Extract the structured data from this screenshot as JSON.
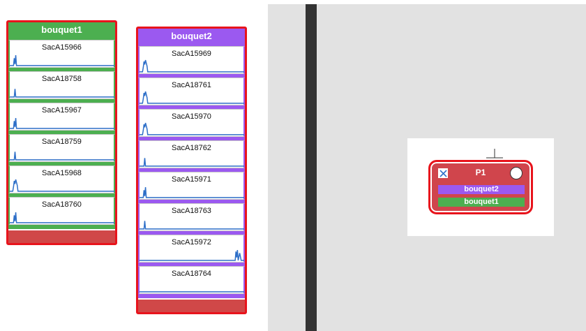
{
  "colors": {
    "selection_border": "#e8141c",
    "bouquet1": "#4caf50",
    "bouquet2": "#9b59f0",
    "node_fill": "#d0454c",
    "trace": "#2e6fc8",
    "footer": "#d04848"
  },
  "bouquets": [
    {
      "title": "bouquet1",
      "color_key": "bouquet1",
      "samples": [
        {
          "label": "SacA15966",
          "trace_shape": "spike-early"
        },
        {
          "label": "SacA18758",
          "trace_shape": "spike-thin"
        },
        {
          "label": "SacA15967",
          "trace_shape": "spike-early"
        },
        {
          "label": "SacA18759",
          "trace_shape": "spike-thin"
        },
        {
          "label": "SacA15968",
          "trace_shape": "spike-wide"
        },
        {
          "label": "SacA18760",
          "trace_shape": "spike-early"
        }
      ]
    },
    {
      "title": "bouquet2",
      "color_key": "bouquet2",
      "samples": [
        {
          "label": "SacA15969",
          "trace_shape": "spike-wide"
        },
        {
          "label": "SacA18761",
          "trace_shape": "spike-wide"
        },
        {
          "label": "SacA15970",
          "trace_shape": "spike-wide"
        },
        {
          "label": "SacA18762",
          "trace_shape": "spike-thin"
        },
        {
          "label": "SacA15971",
          "trace_shape": "spike-early"
        },
        {
          "label": "SacA18763",
          "trace_shape": "spike-thin"
        },
        {
          "label": "SacA15972",
          "trace_shape": "spike-late"
        },
        {
          "label": "SacA18764",
          "trace_shape": "flat"
        }
      ]
    }
  ],
  "node": {
    "title": "P1",
    "checkbox_icon": "x-checkbox-icon",
    "status_icon": "circle-icon",
    "tags": [
      {
        "label": "bouquet2",
        "color_key": "bouquet2"
      },
      {
        "label": "bouquet1",
        "color_key": "bouquet1"
      }
    ]
  }
}
